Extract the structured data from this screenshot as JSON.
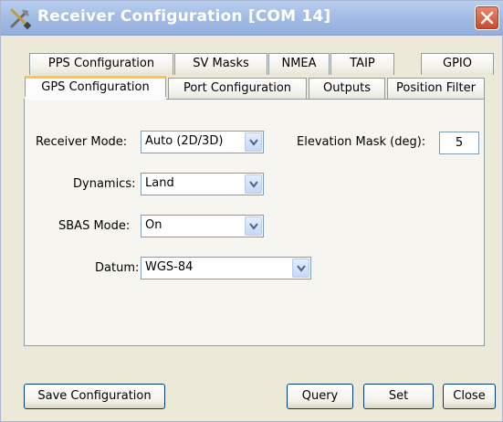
{
  "window": {
    "title": "Receiver Configuration [COM 14]"
  },
  "tabs": {
    "row1": [
      "PPS Configuration",
      "SV Masks",
      "NMEA",
      "TAIP",
      "GPIO"
    ],
    "row2": [
      "GPS Configuration",
      "Port Configuration",
      "Outputs",
      "Position Filter"
    ],
    "active": "GPS Configuration"
  },
  "form": {
    "receiver_mode": {
      "label": "Receiver Mode:",
      "value": "Auto (2D/3D)"
    },
    "elevation_mask": {
      "label": "Elevation Mask (deg):",
      "value": "5"
    },
    "dynamics": {
      "label": "Dynamics:",
      "value": "Land"
    },
    "sbas_mode": {
      "label": "SBAS Mode:",
      "value": "On"
    },
    "datum": {
      "label": "Datum:",
      "value": "WGS-84"
    }
  },
  "buttons": {
    "save": "Save Configuration",
    "query": "Query",
    "set": "Set",
    "close": "Close"
  },
  "colors": {
    "titlebar": "#a3bde6",
    "active_tab_accent": "#ffc83c",
    "dialog_background": "#ece9d8"
  }
}
